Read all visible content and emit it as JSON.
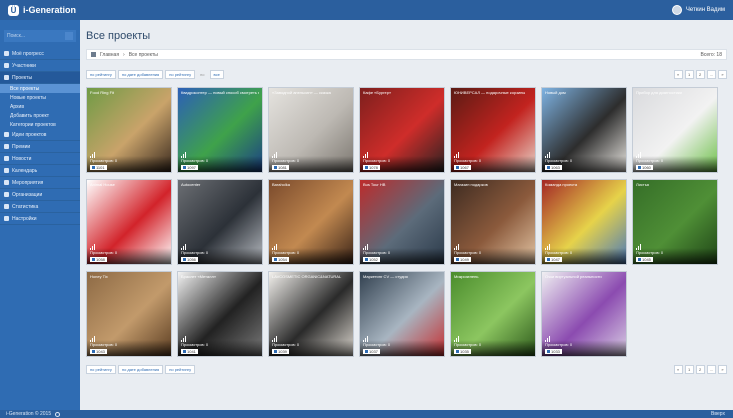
{
  "app": {
    "brand": "i-Generation",
    "user_name": "Четкин Вадим"
  },
  "sidebar": {
    "search_placeholder": "Поиск...",
    "items": [
      {
        "label": "Моё прогресс",
        "active": false
      },
      {
        "label": "Участники",
        "active": false
      },
      {
        "label": "Проекты",
        "active": true
      },
      {
        "label": "Все проекты",
        "sub": true,
        "active": true
      },
      {
        "label": "Новые проекты",
        "sub": true,
        "active": false
      },
      {
        "label": "Архив",
        "sub": true,
        "active": false
      },
      {
        "label": "Добавить проект",
        "sub": true,
        "active": false
      },
      {
        "label": "Категории проектов",
        "sub": true,
        "active": false
      },
      {
        "label": "Идеи проектов",
        "active": false
      },
      {
        "label": "Премии",
        "active": false
      },
      {
        "label": "Новости",
        "active": false
      },
      {
        "label": "Календарь",
        "active": false
      },
      {
        "label": "Мероприятия",
        "active": false
      },
      {
        "label": "Организации",
        "active": false
      },
      {
        "label": "Статистика",
        "active": false
      },
      {
        "label": "Настройки",
        "active": false
      }
    ]
  },
  "page": {
    "title": "Все проекты"
  },
  "breadcrumb": {
    "home": "Главная",
    "current": "Все проекты",
    "right": "Всего: 18"
  },
  "filters": [
    "по рейтингу",
    "по дате добавления",
    "по рейтингу",
    "по",
    "все"
  ],
  "pager": [
    "«",
    "1",
    "2",
    "...",
    "»"
  ],
  "cards": [
    {
      "title": "Food Ring Fit",
      "meta": "Просмотров: 0",
      "id": "1101",
      "colors": [
        "#6f9b45",
        "#c9a36a",
        "#3a2a1f"
      ]
    },
    {
      "title": "Квадрокоптер — новый способ смотреть на мир",
      "meta": "Просмотров: 0",
      "id": "1097",
      "colors": [
        "#2c5fb8",
        "#3fa24a",
        "#1b3f86"
      ]
    },
    {
      "title": "«Заводной апельсин» — сказка",
      "meta": "Просмотров: 0",
      "id": "1081",
      "colors": [
        "#e5e3df",
        "#bdb9b3",
        "#7c7770"
      ]
    },
    {
      "title": "Кафе «Бургер»",
      "meta": "Просмотров: 0",
      "id": "1078",
      "colors": [
        "#7d1f1d",
        "#cf2d2a",
        "#2a2222"
      ]
    },
    {
      "title": "ЮНИВЕРСАЛ — подарочные корзины",
      "meta": "Просмотров: 0",
      "id": "1067",
      "colors": [
        "#5b1b14",
        "#c2231f",
        "#e8d3c8"
      ]
    },
    {
      "title": "Новый дом",
      "meta": "Просмотров: 0",
      "id": "1063",
      "colors": [
        "#7eb3e3",
        "#2d2d2d",
        "#e9e6e1"
      ]
    },
    {
      "title": "Прибор для диагностики",
      "meta": "Просмотров: 0",
      "id": "1060",
      "colors": [
        "#d9dadd",
        "#f2f2f2",
        "#6ec04a"
      ]
    },
    {
      "title": "Animal House",
      "meta": "Просмотров: 0",
      "id": "1058",
      "colors": [
        "#ffffff",
        "#d2232a",
        "#ffffff"
      ]
    },
    {
      "title": "Autocenter",
      "meta": "Просмотров: 0",
      "id": "1056",
      "colors": [
        "#6c6f74",
        "#2c3138",
        "#b8bcc2"
      ]
    },
    {
      "title": "Baraholka",
      "meta": "Просмотров: 0",
      "id": "1054",
      "colors": [
        "#7a4a2c",
        "#c28950",
        "#3b2418"
      ]
    },
    {
      "title": "Bus Tour HB",
      "meta": "Просмотров: 0",
      "id": "1052",
      "colors": [
        "#bd2b2b",
        "#5c6b7a",
        "#2b3a4a"
      ]
    },
    {
      "title": "Магазин подарков",
      "meta": "Просмотров: 0",
      "id": "1049",
      "colors": [
        "#3d2b21",
        "#8b5a3c",
        "#e2c4a3"
      ]
    },
    {
      "title": "Команда проекта",
      "meta": "Просмотров: 0",
      "id": "1047",
      "colors": [
        "#a32626",
        "#e6d24a",
        "#4c7ab9"
      ]
    },
    {
      "title": "Листья",
      "meta": "Просмотров: 0",
      "id": "1045",
      "colors": [
        "#356e28",
        "#4f8f36",
        "#1f4517"
      ]
    },
    {
      "title": "Honey Tix",
      "meta": "Просмотров: 0",
      "id": "1043",
      "colors": [
        "#8d6a45",
        "#c29a6b",
        "#5b3d22"
      ]
    },
    {
      "title": "Браслет «Металл»",
      "meta": "Просмотров: 0",
      "id": "1041",
      "colors": [
        "#f3f3f3",
        "#222222",
        "#7a7a7a"
      ]
    },
    {
      "title": "LAVCOSMETIC ORGANIC&NATURAL",
      "meta": "Просмотров: 0",
      "id": "1039",
      "colors": [
        "#f4f2ee",
        "#2a2a2a",
        "#dcd7cf"
      ]
    },
    {
      "title": "Маркетинг CV — студия",
      "meta": "Просмотров: 0",
      "id": "1037",
      "colors": [
        "#31404f",
        "#a8b5c1",
        "#c53032"
      ]
    },
    {
      "title": "Микрозелень",
      "meta": "Просмотров: 0",
      "id": "1035",
      "colors": [
        "#4a8c2c",
        "#8cc660",
        "#2e5a1c"
      ]
    },
    {
      "title": "Очки виртуальной реальности",
      "meta": "Просмотров: 0",
      "id": "1033",
      "colors": [
        "#f0f0f2",
        "#8b4bb0",
        "#d9cde3"
      ]
    }
  ],
  "footer": {
    "text": "i-Generation © 2015  ",
    "right": "Вверх"
  }
}
